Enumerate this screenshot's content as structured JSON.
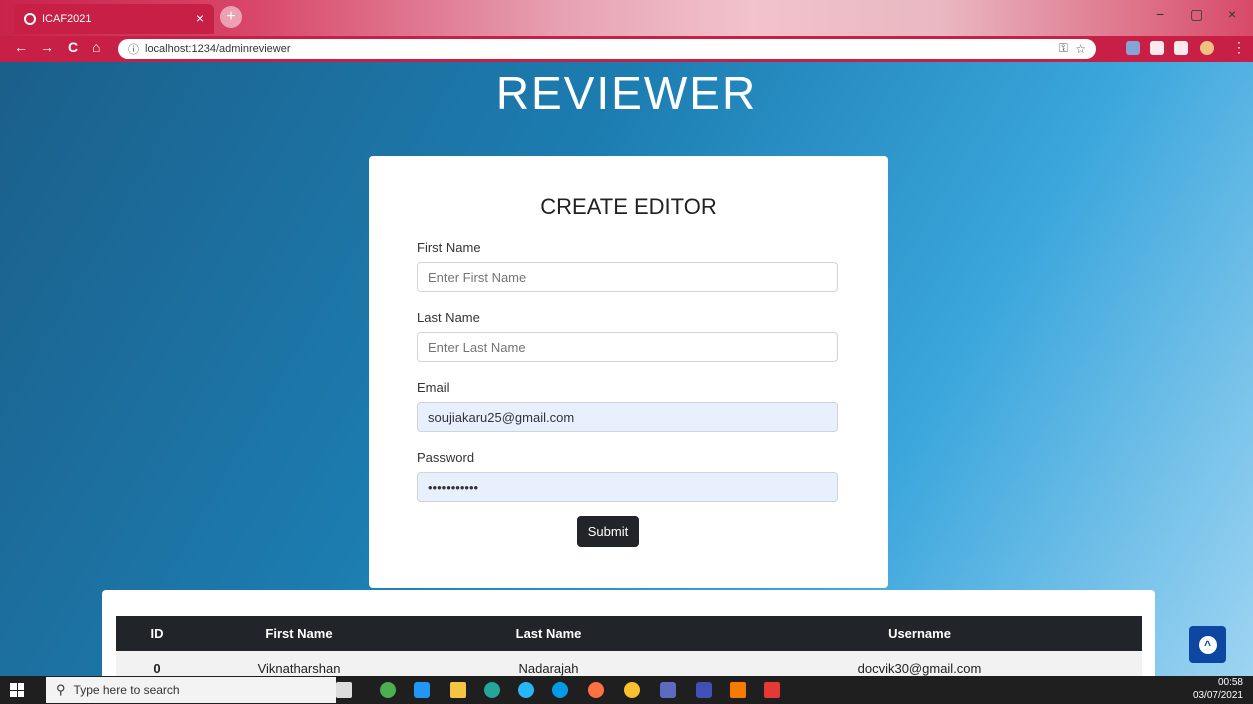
{
  "browser": {
    "tab_title": "ICAF2021",
    "tab_close": "×",
    "new_tab": "+",
    "url": "localhost:1234/adminreviewer",
    "nav": {
      "back": "←",
      "forward": "→",
      "reload": "C",
      "home": "⌂"
    },
    "window_controls": {
      "minimize": "−",
      "maximize": "▢",
      "close": "×"
    }
  },
  "page": {
    "heading": "REVIEWER",
    "form": {
      "title": "CREATE EDITOR",
      "first_name_label": "First Name",
      "first_name_placeholder": "Enter First Name",
      "last_name_label": "Last Name",
      "last_name_placeholder": "Enter Last Name",
      "email_label": "Email",
      "email_value": "soujiakaru25@gmail.com",
      "password_label": "Password",
      "password_value": "•••••••••••",
      "submit_label": "Submit"
    },
    "table": {
      "headers": [
        "ID",
        "First Name",
        "Last Name",
        "Username"
      ],
      "rows": [
        [
          "0",
          "Viknatharshan",
          "Nadarajah",
          "docvik30@gmail.com"
        ]
      ]
    }
  },
  "taskbar": {
    "search_placeholder": "Type here to search",
    "time": "00:58",
    "date": "03/07/2021"
  },
  "colors": {
    "browser_frame": "#c81f47",
    "button_dark": "#212529",
    "scroll_top_button": "#0d47a1"
  }
}
